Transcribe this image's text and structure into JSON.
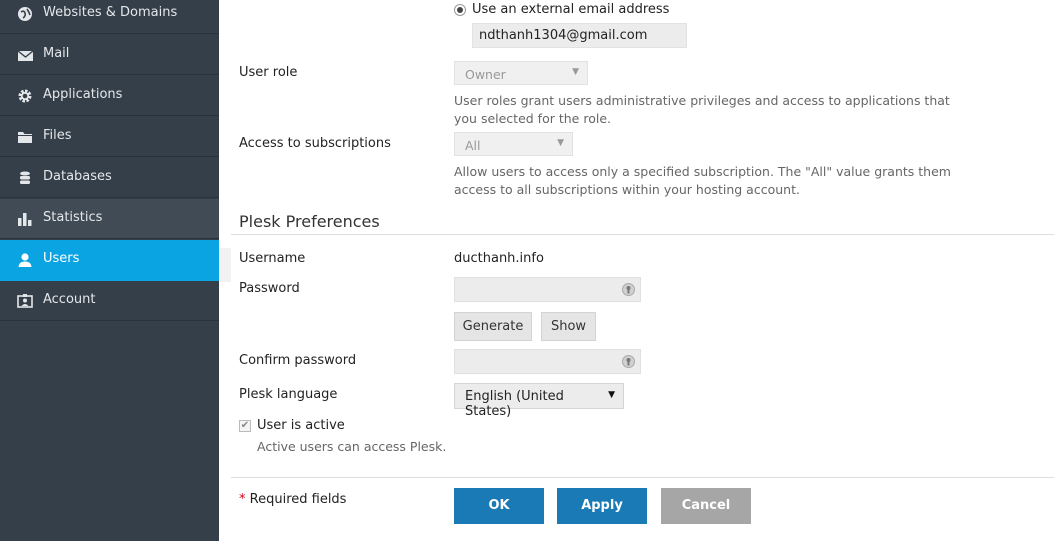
{
  "sidebar": {
    "items": [
      {
        "label": "Websites & Domains",
        "icon": "globe-icon"
      },
      {
        "label": "Mail",
        "icon": "envelope-icon"
      },
      {
        "label": "Applications",
        "icon": "gear-icon"
      },
      {
        "label": "Files",
        "icon": "folder-icon"
      },
      {
        "label": "Databases",
        "icon": "database-icon"
      },
      {
        "label": "Statistics",
        "icon": "bar-chart-icon"
      },
      {
        "label": "Users",
        "icon": "user-icon"
      },
      {
        "label": "Account",
        "icon": "id-card-icon"
      }
    ],
    "active": "Users",
    "active_color": "#0aa4e2",
    "background": "#353f49"
  },
  "email": {
    "radio_label": "Use an external email address",
    "value": "ndthanh1304@gmail.com"
  },
  "user_role": {
    "label": "User role",
    "value": "Owner",
    "hint": "User roles grant users administrative privileges and access to applications that you selected for the role."
  },
  "access": {
    "label": "Access to subscriptions",
    "value": "All",
    "hint": "Allow users to access only a specified subscription. The \"All\" value grants them access to all subscriptions within your hosting account."
  },
  "preferences": {
    "title": "Plesk Preferences",
    "username_label": "Username",
    "username_value": "ducthanh.info",
    "password_label": "Password",
    "generate_label": "Generate",
    "show_label": "Show",
    "confirm_label": "Confirm password",
    "language_label": "Plesk language",
    "language_value": "English (United States)",
    "active_label": "User is active",
    "active_hint": "Active users can access Plesk."
  },
  "footer": {
    "required_star": "*",
    "required_label": "Required fields",
    "ok_label": "OK",
    "apply_label": "Apply",
    "cancel_label": "Cancel",
    "primary_color": "#1a7ab6",
    "cancel_color": "#a6a6a6"
  }
}
